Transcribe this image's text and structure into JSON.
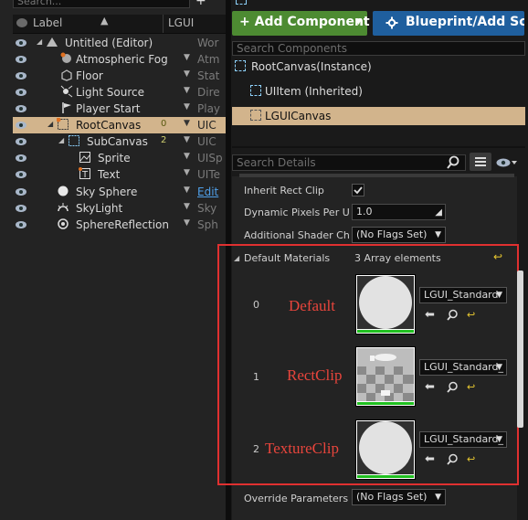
{
  "outliner": {
    "search_placeholder": "Search...",
    "header": {
      "label": "Label",
      "type": "LGUI"
    },
    "rows": [
      {
        "name": "Untitled (Editor)",
        "type": "Wor"
      },
      {
        "name": "Atmospheric Fog",
        "type": "Atm"
      },
      {
        "name": "Floor",
        "type": "Stat"
      },
      {
        "name": "Light Source",
        "type": "Dire"
      },
      {
        "name": "Player Start",
        "type": "Play"
      },
      {
        "name": "RootCanvas",
        "type": "UIC"
      },
      {
        "name": "SubCanvas",
        "type": "UIC"
      },
      {
        "name": "Sprite",
        "type": "UISp"
      },
      {
        "name": "Text",
        "type": "UITe"
      },
      {
        "name": "Sky Sphere",
        "type": "Edit"
      },
      {
        "name": "SkyLight",
        "type": "Sky"
      },
      {
        "name": "SphereReflection",
        "type": "Sph"
      }
    ],
    "badges": {
      "root": "0",
      "sub": "2"
    }
  },
  "toolbar": {
    "add_component": "+ Add Component",
    "blueprint": "Blueprint/Add Scr"
  },
  "components": {
    "search_placeholder": "Search Components",
    "items": [
      "RootCanvas(Instance)",
      "UIItem (Inherited)",
      "LGUICanvas"
    ]
  },
  "details": {
    "search_placeholder": "Search Details",
    "props": {
      "inherit_rect_clip": "Inherit Rect Clip",
      "dynamic_pixels": "Dynamic Pixels Per Un",
      "dynamic_pixels_value": "1.0",
      "additional_shader": "Additional Shader Char",
      "additional_shader_value": "(No Flags Set)",
      "default_materials": "Default Materials",
      "array_count": "3 Array elements",
      "override_parameters": "Override Parameters",
      "override_value": "(No Flags Set)"
    },
    "materials": [
      {
        "index": "0",
        "annotation": "Default",
        "material": "LGUI_Standard"
      },
      {
        "index": "1",
        "annotation": "RectClip",
        "material": "LGUI_Standard_"
      },
      {
        "index": "2",
        "annotation": "TextureClip",
        "material": "LGUI_Standard_"
      }
    ]
  },
  "colors": {
    "accent_green": "#4d8b32",
    "accent_blue": "#1f5f9e",
    "selection": "#d2b48c",
    "highlight_red": "#e03030"
  }
}
